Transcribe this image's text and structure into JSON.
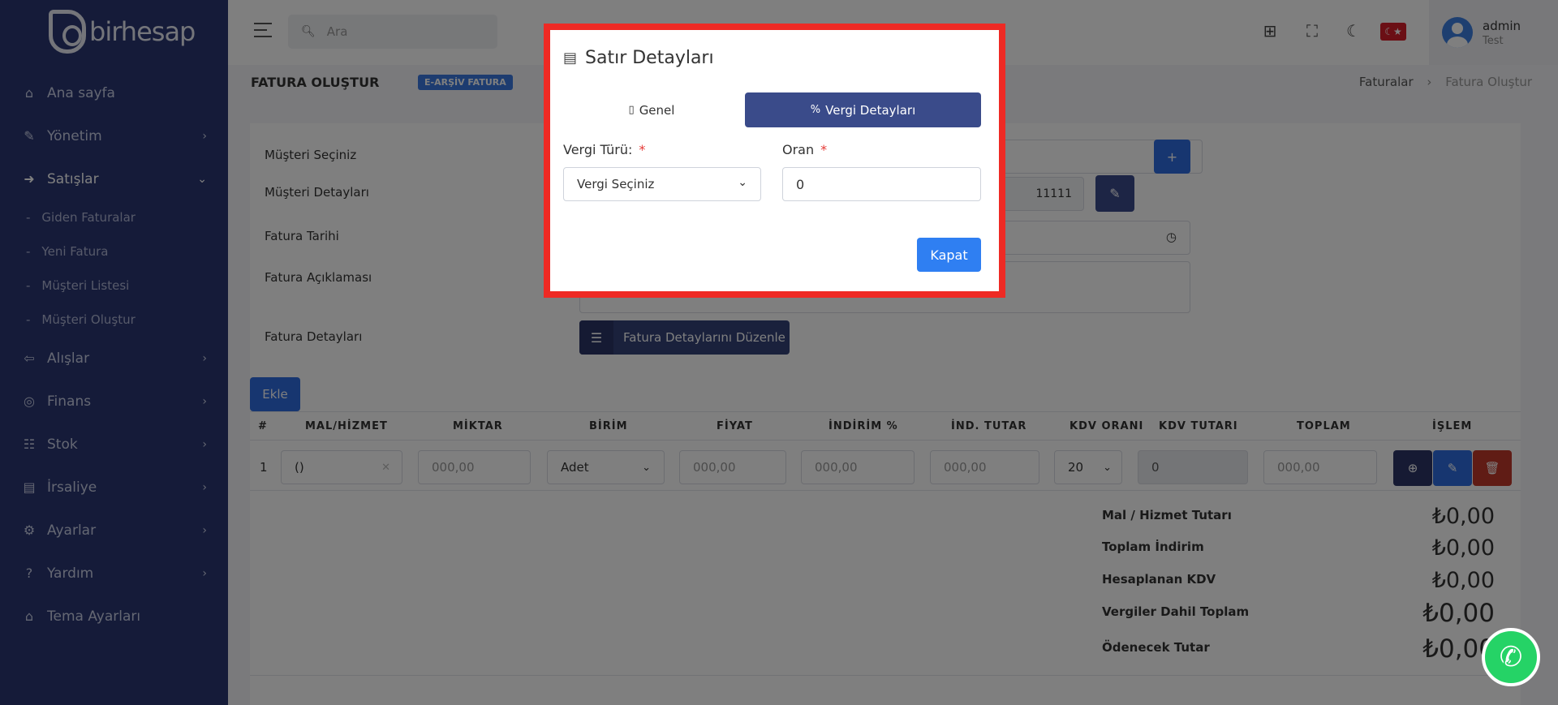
{
  "app": {
    "logo_text": "birhesap"
  },
  "sidebar": {
    "items": [
      {
        "label": "Ana sayfa",
        "icon": "home-icon"
      },
      {
        "label": "Yönetim",
        "icon": "wrench-icon"
      },
      {
        "label": "Satışlar",
        "icon": "sales-icon"
      },
      {
        "label": "Alışlar",
        "icon": "purchase-icon"
      },
      {
        "label": "Finans",
        "icon": "finance-icon"
      },
      {
        "label": "Stok",
        "icon": "stock-icon"
      },
      {
        "label": "İrsaliye",
        "icon": "waybill-icon"
      },
      {
        "label": "Ayarlar",
        "icon": "gear-icon"
      },
      {
        "label": "Yardım",
        "icon": "help-icon"
      },
      {
        "label": "Tema Ayarları",
        "icon": "theme-icon"
      }
    ],
    "sales_sub": [
      "Giden Faturalar",
      "Yeni Fatura",
      "Müşteri Listesi",
      "Müşteri Oluştur"
    ]
  },
  "topbar": {
    "search_placeholder": "Ara",
    "user_name": "admin",
    "user_role": "Test"
  },
  "page": {
    "title": "FATURA OLUŞTUR",
    "badge": "E-ARŞİV FATURA",
    "breadcrumb": [
      "Faturalar",
      "Fatura Oluştur"
    ]
  },
  "form": {
    "customer_label": "Müşteri Seçiniz",
    "customer_details_label": "Müşteri Detayları",
    "customer_details_value": "11111",
    "invoice_date_label": "Fatura Tarihi",
    "invoice_desc_label": "Fatura Açıklaması",
    "invoice_details_label": "Fatura Detayları",
    "invoice_details_button": "Fatura Detaylarını Düzenle",
    "add_button": "Ekle",
    "plus": "+"
  },
  "table": {
    "headers": [
      "#",
      "MAL/HİZMET",
      "MİKTAR",
      "BİRİM",
      "FİYAT",
      "İNDİRİM %",
      "İND. TUTAR",
      "KDV ORANI",
      "KDV TUTARI",
      "TOPLAM",
      "İŞLEM"
    ],
    "row": {
      "index": "1",
      "item": "()",
      "quantity_placeholder": "000,00",
      "unit": "Adet",
      "price_placeholder": "000,00",
      "discount_pct_placeholder": "000,00",
      "discount_amt_placeholder": "000,00",
      "vat_rate": "20",
      "vat_amount": "0",
      "total_placeholder": "000,00"
    }
  },
  "totals": [
    {
      "label": "Mal / Hizmet Tutarı",
      "value": "₺0,00"
    },
    {
      "label": "Toplam İndirim",
      "value": "₺0,00"
    },
    {
      "label": "Hesaplanan KDV",
      "value": "₺0,00"
    },
    {
      "label": "Vergiler Dahil Toplam",
      "value": "₺0,00"
    },
    {
      "label": "Ödenecek Tutar",
      "value": "₺0,00"
    }
  ],
  "modal": {
    "title": "Satır Detayları",
    "tab_general": "Genel",
    "tab_tax": "Vergi Detayları",
    "tax_type_label": "Vergi Türü:",
    "tax_type_value": "Vergi Seçiniz",
    "rate_label": "Oran",
    "rate_value": "0",
    "required_mark": "*",
    "close_button": "Kapat"
  },
  "colors": {
    "sidebar": "#2a3773",
    "primary": "#2f6de0",
    "navy": "#3a4b8a",
    "danger": "#c0392b",
    "highlight": "#ee2a24",
    "whatsapp": "#25d366"
  }
}
